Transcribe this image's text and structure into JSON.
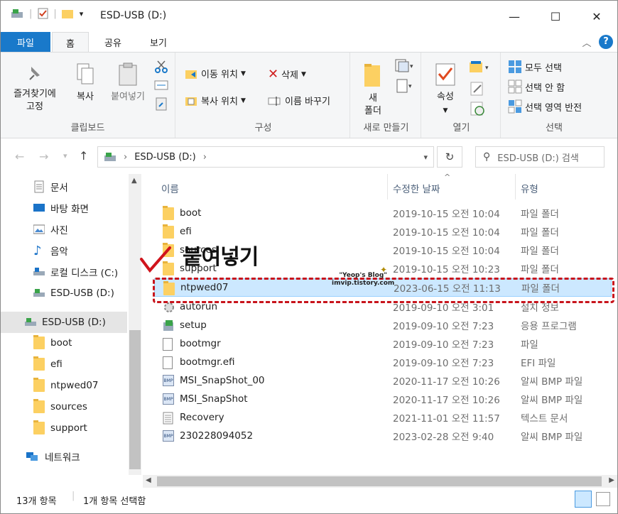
{
  "window": {
    "title": "ESD-USB (D:)",
    "minimize": "—",
    "maximize": "☐",
    "close": "✕"
  },
  "tabs": {
    "file": "파일",
    "home": "홈",
    "share": "공유",
    "view": "보기"
  },
  "ribbon": {
    "clipboard": {
      "pin": "즐겨찾기에",
      "pin2": "고정",
      "copy": "복사",
      "paste": "붙여넣기",
      "label": "클립보드"
    },
    "organize": {
      "move": "이동 위치",
      "copyto": "복사 위치",
      "delete": "삭제",
      "rename": "이름 바꾸기",
      "label": "구성"
    },
    "new": {
      "folder1": "새",
      "folder2": "폴더",
      "label": "새로 만들기"
    },
    "open": {
      "properties": "속성",
      "label": "열기"
    },
    "select": {
      "all": "모두 선택",
      "none": "선택 안 함",
      "invert": "선택 영역 반전",
      "label": "선택"
    }
  },
  "address": {
    "path": "ESD-USB (D:)",
    "search_placeholder": "ESD-USB (D:) 검색"
  },
  "nav": {
    "items": [
      {
        "label": "문서"
      },
      {
        "label": "바탕 화면"
      },
      {
        "label": "사진"
      },
      {
        "label": "음악"
      },
      {
        "label": "로컬 디스크 (C:)"
      },
      {
        "label": "ESD-USB (D:)"
      },
      {
        "label": "ESD-USB (D:)"
      },
      {
        "label": "boot"
      },
      {
        "label": "efi"
      },
      {
        "label": "ntpwed07"
      },
      {
        "label": "sources"
      },
      {
        "label": "support"
      },
      {
        "label": "네트워크"
      }
    ]
  },
  "columns": {
    "name": "이름",
    "date": "수정한 날짜",
    "type": "유형"
  },
  "files": [
    {
      "name": "boot",
      "date": "2019-10-15 오전 10:04",
      "type": "파일 폴더",
      "icon": "folder-icon"
    },
    {
      "name": "efi",
      "date": "2019-10-15 오전 10:04",
      "type": "파일 폴더",
      "icon": "folder-icon"
    },
    {
      "name": "sources",
      "date": "2019-10-15 오전 10:04",
      "type": "파일 폴더",
      "icon": "folder-icon"
    },
    {
      "name": "support",
      "date": "2019-10-15 오전 10:23",
      "type": "파일 폴더",
      "icon": "folder-icon"
    },
    {
      "name": "ntpwed07",
      "date": "2023-06-15 오전 11:13",
      "type": "파일 폴더",
      "icon": "folder-icon"
    },
    {
      "name": "autorun",
      "date": "2019-09-10 오전 3:01",
      "type": "설치 정보",
      "icon": "settings-file-icon"
    },
    {
      "name": "setup",
      "date": "2019-09-10 오전 7:23",
      "type": "응용 프로그램",
      "icon": "setup-icon"
    },
    {
      "name": "bootmgr",
      "date": "2019-09-10 오전 7:23",
      "type": "파일",
      "icon": "file-icon"
    },
    {
      "name": "bootmgr.efi",
      "date": "2019-09-10 오전 7:23",
      "type": "EFI 파일",
      "icon": "file-icon"
    },
    {
      "name": "MSI_SnapShot_00",
      "date": "2020-11-17 오전 10:26",
      "type": "알씨 BMP 파일",
      "icon": "bmp-icon"
    },
    {
      "name": "MSI_SnapShot",
      "date": "2020-11-17 오전 10:26",
      "type": "알씨 BMP 파일",
      "icon": "bmp-icon"
    },
    {
      "name": "Recovery",
      "date": "2021-11-01 오전 11:57",
      "type": "텍스트 문서",
      "icon": "text-file-icon"
    },
    {
      "name": "230228094052",
      "date": "2023-02-28 오전 9:40",
      "type": "알씨 BMP 파일",
      "icon": "bmp-icon"
    }
  ],
  "annotation": {
    "text": "붙여넣기",
    "watermark1": "\"Yeop's Blog\"",
    "watermark2": "imvip.tistory.com"
  },
  "status": {
    "count": "13개 항목",
    "selected": "1개 항목 선택함"
  },
  "colors": {
    "accent": "#1979ca",
    "selection": "#cce8ff",
    "highlight": "#c8141c"
  }
}
